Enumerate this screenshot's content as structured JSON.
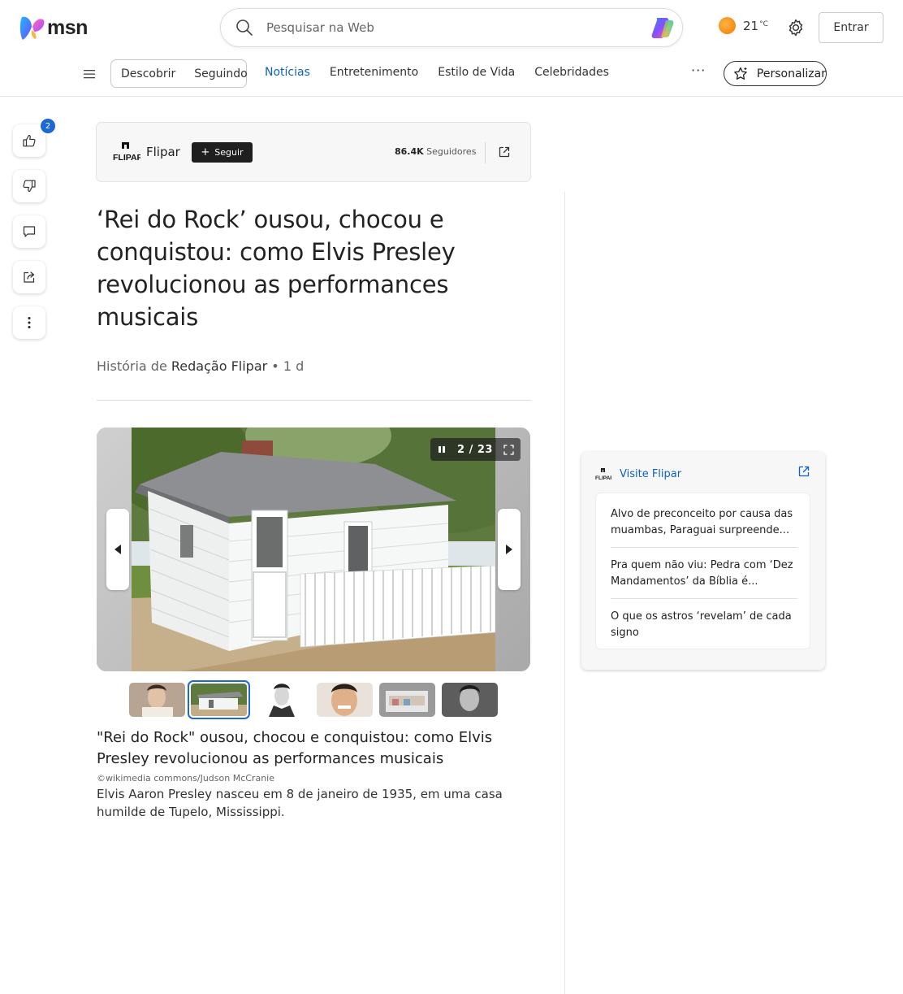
{
  "header": {
    "logo_text": "msn",
    "search_placeholder": "Pesquisar na Web",
    "weather_temp": "21",
    "weather_unit": "°C",
    "signin_label": "Entrar"
  },
  "nav": {
    "segments": [
      "Descobrir",
      "Seguindo"
    ],
    "links": [
      "Notícias",
      "Entretenimento",
      "Estilo de Vida",
      "Celebridades"
    ],
    "active_link": "Notícias",
    "more_label": "···",
    "personalize_label": "Personalizar"
  },
  "rail": {
    "like_count": "2"
  },
  "publisher": {
    "name": "Flipar",
    "logo_text": "FLIPAR",
    "follow_plus": "+",
    "follow_label": "Seguir",
    "followers_count": "86.4K",
    "followers_label": "Seguidores"
  },
  "article": {
    "title": "‘Rei do Rock’ ousou, chocou e conquistou: como Elvis Presley revolucionou as performances musicais",
    "byline_prefix": "História de",
    "author": "Redação Flipar",
    "age": "• 1 d"
  },
  "slideshow": {
    "counter": "2 / 23",
    "caption_title": "\"Rei do Rock\" ousou, chocou e conquistou: como Elvis Presley revolucionou as performances musicais",
    "credit": "©wikimedia commons/Judson McCranie",
    "caption_text": "Elvis Aaron Presley nasceu em 8 de janeiro de 1935, em uma casa humilde de Tupelo, Mississippi.",
    "active_thumb_index": 1,
    "thumb_count": 6
  },
  "sidebar": {
    "title": "Visite Flipar",
    "items": [
      "Alvo de preconceito por causa das muambas, Paraguai surpreende...",
      "Pra quem não viu: Pedra com ‘Dez Mandamentos’ da Bíblia é...",
      "O que os astros ‘revelam’ de cada signo"
    ]
  },
  "colors": {
    "accent": "#0b62c4",
    "badge": "#1b6ad2",
    "follow_button": "#1f1f1f"
  }
}
